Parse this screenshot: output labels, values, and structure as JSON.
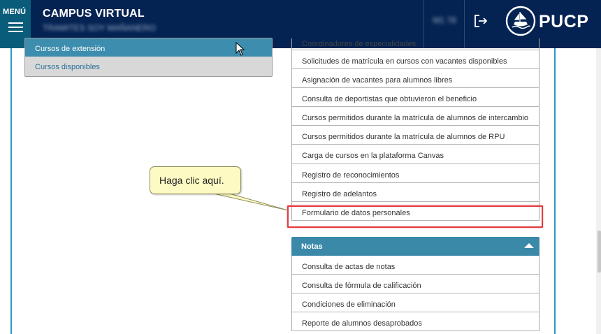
{
  "header": {
    "menu_label": "MENÚ",
    "title": "CAMPUS VIRTUAL",
    "subtitle": "TRAMITES SOY MAÑANERO",
    "user_code": "M1  78",
    "logo_text": "PUCP"
  },
  "left_card": {
    "heading": "Cursos de extensión",
    "items": [
      "Cursos disponibles"
    ]
  },
  "list_top": [
    "Coordinadores de especialidades",
    "Solicitudes de matrícula en cursos con vacantes disponibles",
    "Asignación de vacantes para alumnos libres",
    "Consulta de deportistas que obtuvieron el beneficio",
    "Cursos permitidos durante la matrícula de alumnos de intercambio",
    "Cursos permitidos durante la matrícula de alumnos de RPU",
    "Carga de cursos en la plataforma Canvas",
    "Registro de reconocimientos",
    "Registro de adelantos",
    "Formulario de datos personales"
  ],
  "section_notas": {
    "heading": "Notas",
    "items": [
      "Consulta de actas de notas",
      "Consulta de fórmula de calificación",
      "Condiciones de eliminación",
      "Reporte de alumnos desaprobados"
    ]
  },
  "callout": {
    "text": "Haga clic aquí."
  },
  "colors": {
    "header_bg": "#042352",
    "accent": "#3a89a9",
    "highlight": "#e23a3f",
    "callout_bg": "#fdfac4"
  }
}
